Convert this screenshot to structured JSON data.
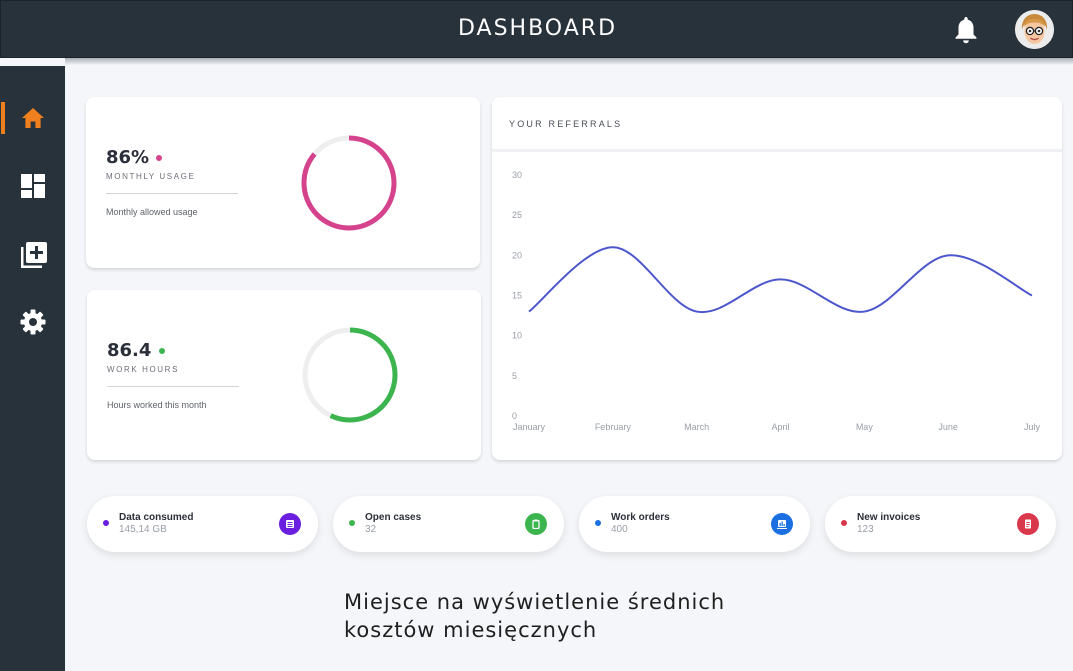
{
  "header": {
    "title": "DASHBOARD"
  },
  "sidebar": {
    "items": [
      {
        "icon": "home-icon",
        "active": true
      },
      {
        "icon": "dashboard-icon",
        "active": false
      },
      {
        "icon": "add-note-icon",
        "active": false
      },
      {
        "icon": "settings-icon",
        "active": false
      }
    ]
  },
  "metrics": [
    {
      "value": "86%",
      "percent": 86,
      "label": "MONTHLY USAGE",
      "description": "Monthly allowed usage",
      "color": "#d6438d"
    },
    {
      "value": "86.4",
      "percent": 57,
      "label": "WORK HOURS",
      "description": "Hours worked this month",
      "color": "#3cb54e"
    }
  ],
  "referrals": {
    "title": "YOUR REFERRALS"
  },
  "chart_data": {
    "type": "line",
    "title": "",
    "x": [
      "January",
      "February",
      "March",
      "April",
      "May",
      "June",
      "July"
    ],
    "series": [
      {
        "values": [
          13,
          21,
          13,
          17,
          13,
          20,
          15
        ],
        "color": "#4d57cc"
      }
    ],
    "yticks": [
      0,
      5,
      10,
      15,
      20,
      25,
      30
    ],
    "ylim": [
      0,
      30
    ],
    "grid": false
  },
  "stats": [
    {
      "label": "Data consumed",
      "value": "145,14 GB",
      "dot_color": "#6a1ee0",
      "icon": "list-icon",
      "icon_color": "#6a1ee0"
    },
    {
      "label": "Open cases",
      "value": "32",
      "dot_color": "#3cb54e",
      "icon": "clipboard-icon",
      "icon_color": "#3cb54e"
    },
    {
      "label": "Work orders",
      "value": "400",
      "dot_color": "#1b6fe0",
      "icon": "chart-icon",
      "icon_color": "#1b6fe0"
    },
    {
      "label": "New invoices",
      "value": "123",
      "dot_color": "#d9384a",
      "icon": "invoice-icon",
      "icon_color": "#d9384a"
    }
  ],
  "note": {
    "line1": "Miejsce na wyświetlenie średnich",
    "line2": "kosztów miesięcznych"
  },
  "colors": {
    "header": "#28323b",
    "active_nav": "#f07f1e",
    "background": "#f4f6f9"
  }
}
